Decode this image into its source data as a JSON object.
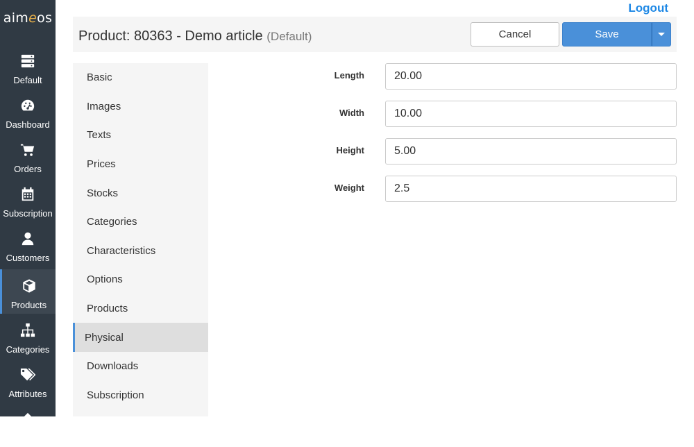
{
  "app": {
    "logo_prefix": "aim",
    "logo_e": "e",
    "logo_suffix": "os"
  },
  "nav": {
    "items": [
      {
        "label": "Default",
        "icon": "server-icon"
      },
      {
        "label": "Dashboard",
        "icon": "dashboard-icon"
      },
      {
        "label": "Orders",
        "icon": "cart-icon"
      },
      {
        "label": "Subscription",
        "icon": "calendar-icon"
      },
      {
        "label": "Customers",
        "icon": "user-icon"
      },
      {
        "label": "Products",
        "icon": "box-icon",
        "active": true
      },
      {
        "label": "Categories",
        "icon": "sitemap-icon"
      },
      {
        "label": "Attributes",
        "icon": "tags-icon"
      }
    ]
  },
  "header": {
    "logout": "Logout",
    "title": "Product: 80363 - Demo article",
    "site": "(Default)",
    "cancel": "Cancel",
    "save": "Save"
  },
  "tabs": [
    {
      "label": "Basic"
    },
    {
      "label": "Images"
    },
    {
      "label": "Texts"
    },
    {
      "label": "Prices"
    },
    {
      "label": "Stocks"
    },
    {
      "label": "Categories"
    },
    {
      "label": "Characteristics"
    },
    {
      "label": "Options"
    },
    {
      "label": "Products"
    },
    {
      "label": "Physical",
      "active": true
    },
    {
      "label": "Downloads"
    },
    {
      "label": "Subscription"
    }
  ],
  "physical": {
    "length": {
      "label": "Length",
      "value": "20.00"
    },
    "width": {
      "label": "Width",
      "value": "10.00"
    },
    "height": {
      "label": "Height",
      "value": "5.00"
    },
    "weight": {
      "label": "Weight",
      "value": "2.5"
    }
  },
  "colors": {
    "sidebar_bg": "#303a44",
    "accent": "#4a90d9",
    "link": "#1e88e5"
  }
}
